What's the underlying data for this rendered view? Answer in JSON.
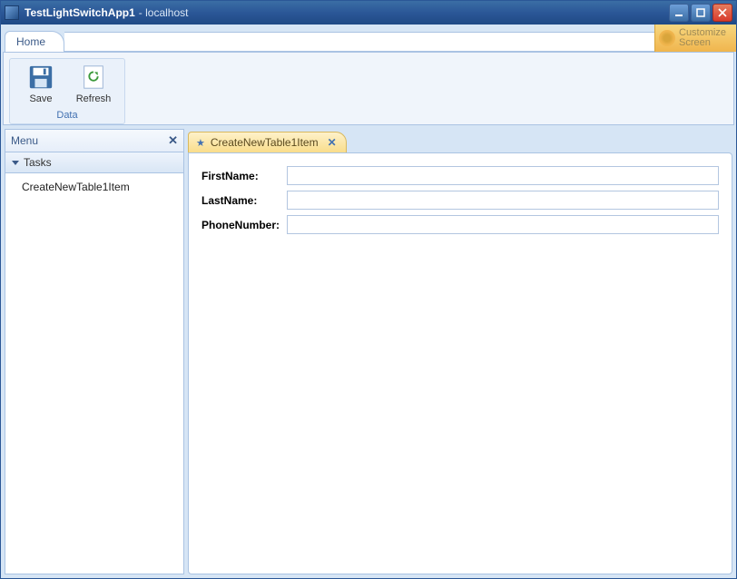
{
  "window": {
    "appTitle": "TestLightSwitchApp1",
    "host": " - localhost",
    "customize": {
      "line1": "Customize",
      "line2": "Screen"
    }
  },
  "tabs": {
    "home": "Home"
  },
  "ribbon": {
    "save": "Save",
    "refresh": "Refresh",
    "groupLabel": "Data"
  },
  "sidebar": {
    "menuTitle": "Menu",
    "accordion": "Tasks",
    "items": [
      "CreateNewTable1Item"
    ]
  },
  "document": {
    "tabTitle": "CreateNewTable1Item",
    "fields": [
      {
        "label": "FirstName:",
        "value": ""
      },
      {
        "label": "LastName:",
        "value": ""
      },
      {
        "label": "PhoneNumber:",
        "value": ""
      }
    ]
  }
}
